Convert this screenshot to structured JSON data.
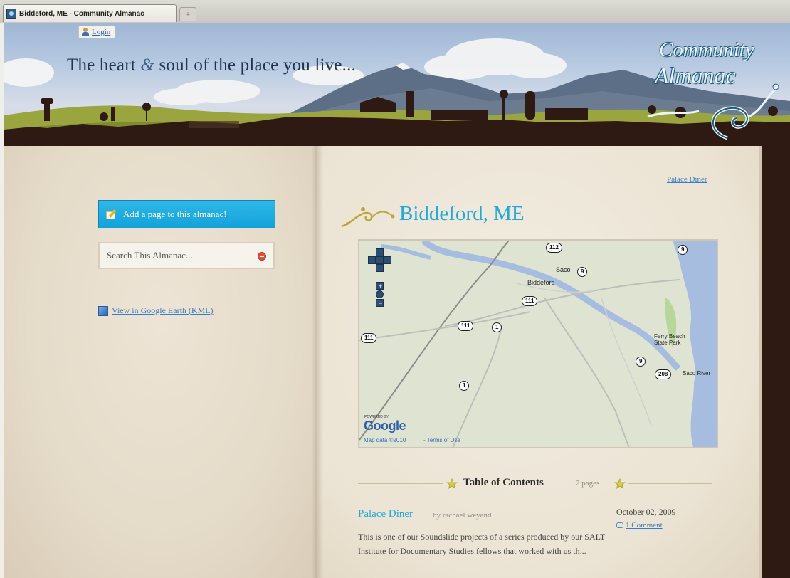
{
  "browser": {
    "tab_title": "Biddeford, ME - Community Almanac",
    "new_tab_label": "+"
  },
  "header": {
    "login_label": "Login",
    "tagline_part1": "The heart",
    "tagline_amp": "&",
    "tagline_part2": "soul of the place you live...",
    "logo_word1": "Community",
    "logo_word2": "Almanac"
  },
  "sidebar": {
    "add_page_label": "Add a page to this almanac!",
    "search_placeholder": "Search This Almanac...",
    "kml_link": "View in Google Earth (KML)"
  },
  "main": {
    "top_link": "Palace Diner",
    "page_title": "Biddeford, ME",
    "map": {
      "places": [
        "Saco",
        "Biddeford",
        "Ferry Beach State Park",
        "Saco River"
      ],
      "routes": [
        "112",
        "9",
        "9",
        "111",
        "111",
        "111",
        "1",
        "1",
        "9",
        "208"
      ],
      "zoom_in": "+",
      "zoom_out": "−",
      "powered_by": "POWERED BY",
      "google_logo": "Google",
      "map_data": "Map data ©2010",
      "terms": "- Terms of Use"
    },
    "toc": {
      "title": "Table of Contents",
      "count": "2 pages"
    },
    "entries": [
      {
        "title": "Palace Diner",
        "author": "by rachael weyand",
        "date": "October 02, 2009",
        "comments": "1 Comment",
        "excerpt": "This is one of our Soundslide projects of a series produced by our SALT Institute for Documentary Studies fellows that worked with us th..."
      }
    ]
  },
  "colors": {
    "accent_blue": "#24a8d8",
    "button_blue": "#12a2da",
    "link_blue": "#3d7cc2",
    "dark_brown": "#2e1a12"
  }
}
